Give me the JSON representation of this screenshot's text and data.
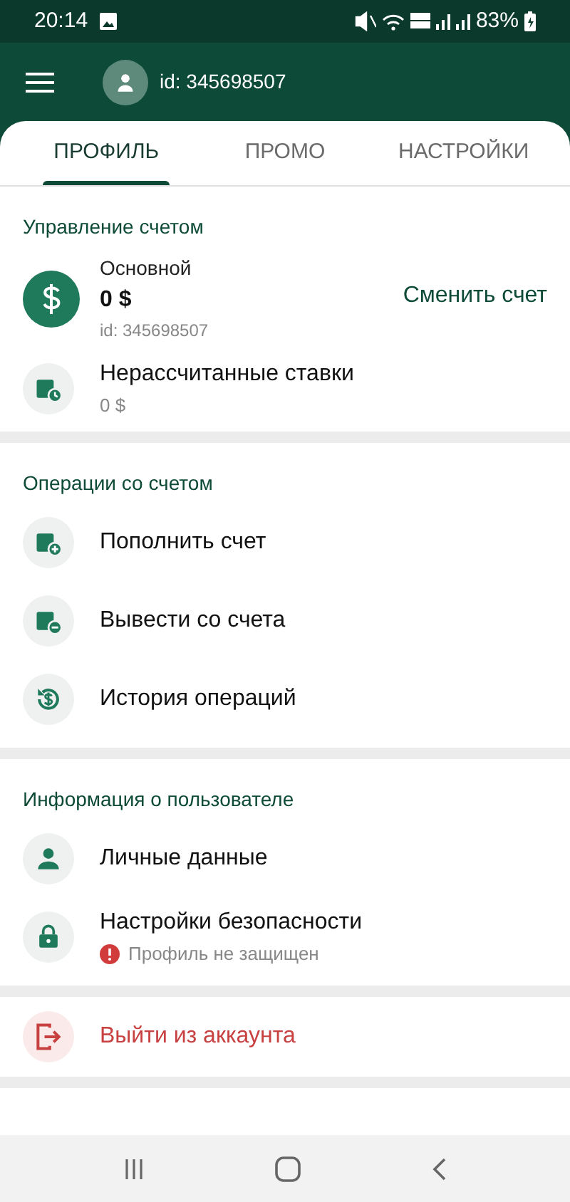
{
  "status_bar": {
    "time": "20:14",
    "battery": "83%"
  },
  "header": {
    "user_id": "id: 345698507"
  },
  "tabs": [
    {
      "label": "ПРОФИЛЬ",
      "selected": true
    },
    {
      "label": "ПРОМО",
      "selected": false
    },
    {
      "label": "НАСТРОЙКИ",
      "selected": false
    }
  ],
  "account": {
    "title": "Управление счетом",
    "name": "Основной",
    "balance": "0 $",
    "id": "id: 345698507",
    "action": "Сменить счет"
  },
  "unsettled": {
    "label": "Нерассчитанные ставки",
    "value": "0 $"
  },
  "sections": [
    {
      "title": "Операции со счетом",
      "items": [
        {
          "kind": "wallet-plus",
          "label": "Пополнить счет"
        },
        {
          "kind": "wallet-minus",
          "label": "Вывести со счета"
        },
        {
          "kind": "history",
          "label": "История операций"
        }
      ]
    },
    {
      "title": "Информация о пользователе",
      "items": [
        {
          "kind": "person",
          "label": "Личные данные"
        },
        {
          "kind": "lock",
          "label": "Настройки безопасности",
          "warning": "Профиль не защищен"
        }
      ]
    }
  ],
  "logout": {
    "label": "Выйти из аккаунта"
  }
}
